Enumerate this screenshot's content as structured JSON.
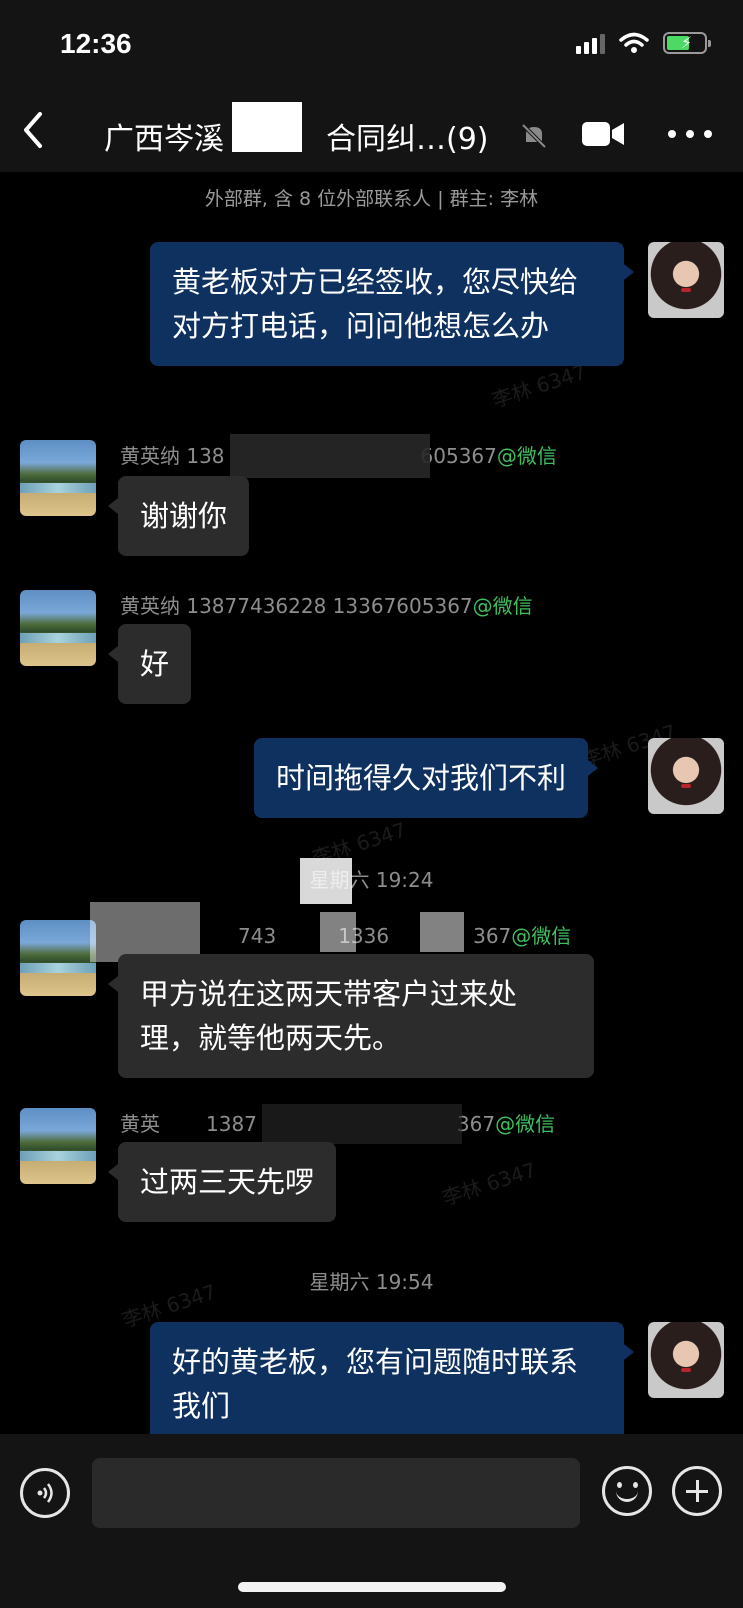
{
  "status_bar": {
    "time": "12:36"
  },
  "nav": {
    "title": "广西岑溪",
    "title_suffix": "合同纠…(9)",
    "icons": [
      "back-icon",
      "mute-icon",
      "video-call-icon",
      "more-icon"
    ]
  },
  "group_info": "外部群, 含 8 位外部联系人 | 群主: 李林",
  "messages": [
    {
      "dir": "out",
      "text": "黄老板对方已经签收，您尽快给对方打电话，问问他想怎么办"
    },
    {
      "dir": "in",
      "sender": "黄英纳  138",
      "sender_tail": "605367",
      "wx": "@微信",
      "text": "谢谢你"
    },
    {
      "dir": "in",
      "sender": "黄英纳  13877436228  13367605367",
      "wx": "@微信",
      "text": "好"
    },
    {
      "dir": "out",
      "text": "时间拖得久对我们不利"
    },
    {
      "dir": "in",
      "sender": "743",
      "sender_mid": "1336",
      "sender_tail": "367",
      "wx": "@微信",
      "text": "甲方说在这两天带客户过来处理，就等他两天先。"
    },
    {
      "dir": "in",
      "sender": "黄英",
      "sender_mid": "1387",
      "sender_tail": "367",
      "wx": "@微信",
      "text": "过两三天先啰"
    },
    {
      "dir": "out",
      "text": "好的黄老板，您有问题随时联系我们"
    }
  ],
  "timestamps": [
    "星期六 19:24",
    "星期六 19:54"
  ],
  "watermark": "李林 6347",
  "input_bar": {
    "placeholder": ""
  }
}
